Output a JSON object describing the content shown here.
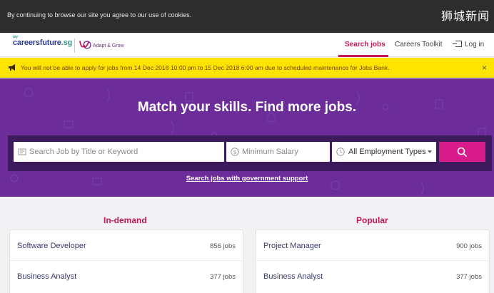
{
  "cookie_bar": {
    "text": "By continuing to browse our site you agree to our use of cookies.",
    "watermark": "狮城新闻"
  },
  "header": {
    "logo_main": "careersfuture",
    "logo_suffix": ".sg",
    "logo_prefix": "my",
    "adapt_grow": "Adapt & Grow",
    "nav": {
      "search_jobs": "Search jobs",
      "careers_toolkit": "Careers Toolkit",
      "log_in": "Log in"
    }
  },
  "maintenance": {
    "text": "You will not be able to apply for jobs from 14 Dec 2018 10:00 pm to 15 Dec 2018 6:00 am due to scheduled maintenance for Jobs Bank.",
    "close": "×"
  },
  "hero": {
    "title": "Match your skills. Find more jobs.",
    "search": {
      "job_placeholder": "Search Job by Title or Keyword",
      "salary_placeholder": "Minimum Salary",
      "employment_type": "All Employment Types"
    },
    "gov_link": "Search jobs with government support"
  },
  "in_demand": {
    "title": "In-demand",
    "items": [
      {
        "name": "Software Developer",
        "count": "856 jobs"
      },
      {
        "name": "Business Analyst",
        "count": "377 jobs"
      }
    ]
  },
  "popular": {
    "title": "Popular",
    "items": [
      {
        "name": "Project Manager",
        "count": "900 jobs"
      },
      {
        "name": "Business Analyst",
        "count": "377 jobs"
      }
    ]
  },
  "colors": {
    "hero_purple": "#6c2d9b",
    "accent_magenta": "#d81b8a",
    "maintenance_yellow": "#ffe400",
    "nav_active": "#c2185b"
  },
  "icons": [
    "megaphone-icon",
    "close-icon",
    "job-card-icon",
    "dollar-icon",
    "clock-icon",
    "chevron-down-icon",
    "search-icon",
    "login-icon"
  ]
}
